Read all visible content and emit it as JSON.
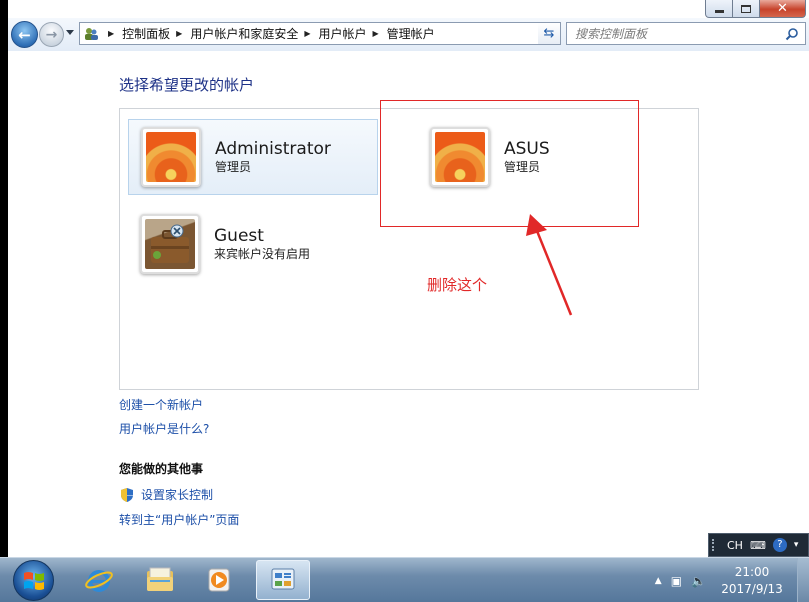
{
  "window": {
    "breadcrumb": [
      "控制面板",
      "用户帐户和家庭安全",
      "用户帐户",
      "管理帐户"
    ],
    "search_placeholder": "搜索控制面板"
  },
  "content": {
    "heading": "选择希望更改的帐户",
    "accounts": [
      {
        "name": "Administrator",
        "type": "管理员",
        "picture": "flower",
        "selected": true
      },
      {
        "name": "ASUS",
        "type": "管理员",
        "picture": "flower",
        "selected": false
      },
      {
        "name": "Guest",
        "type": "来宾帐户没有启用",
        "picture": "briefcase",
        "selected": false
      }
    ],
    "links": [
      "创建一个新帐户",
      "用户帐户是什么?"
    ],
    "other_tasks_heading": "您能做的其他事",
    "other_tasks": [
      "设置家长控制",
      "转到主“用户帐户”页面"
    ]
  },
  "annotation": {
    "text": "删除这个",
    "color": "#e12828"
  },
  "langbar": {
    "lang": "CH"
  },
  "taskbar": {
    "pinned": [
      "internet-explorer",
      "windows-explorer",
      "media-player",
      "control-panel"
    ],
    "active": "control-panel",
    "time": "21:00",
    "date": "2017/9/13"
  },
  "colors": {
    "link": "#1c4fa8",
    "heading": "#1e3287",
    "annotation": "#e12828"
  }
}
